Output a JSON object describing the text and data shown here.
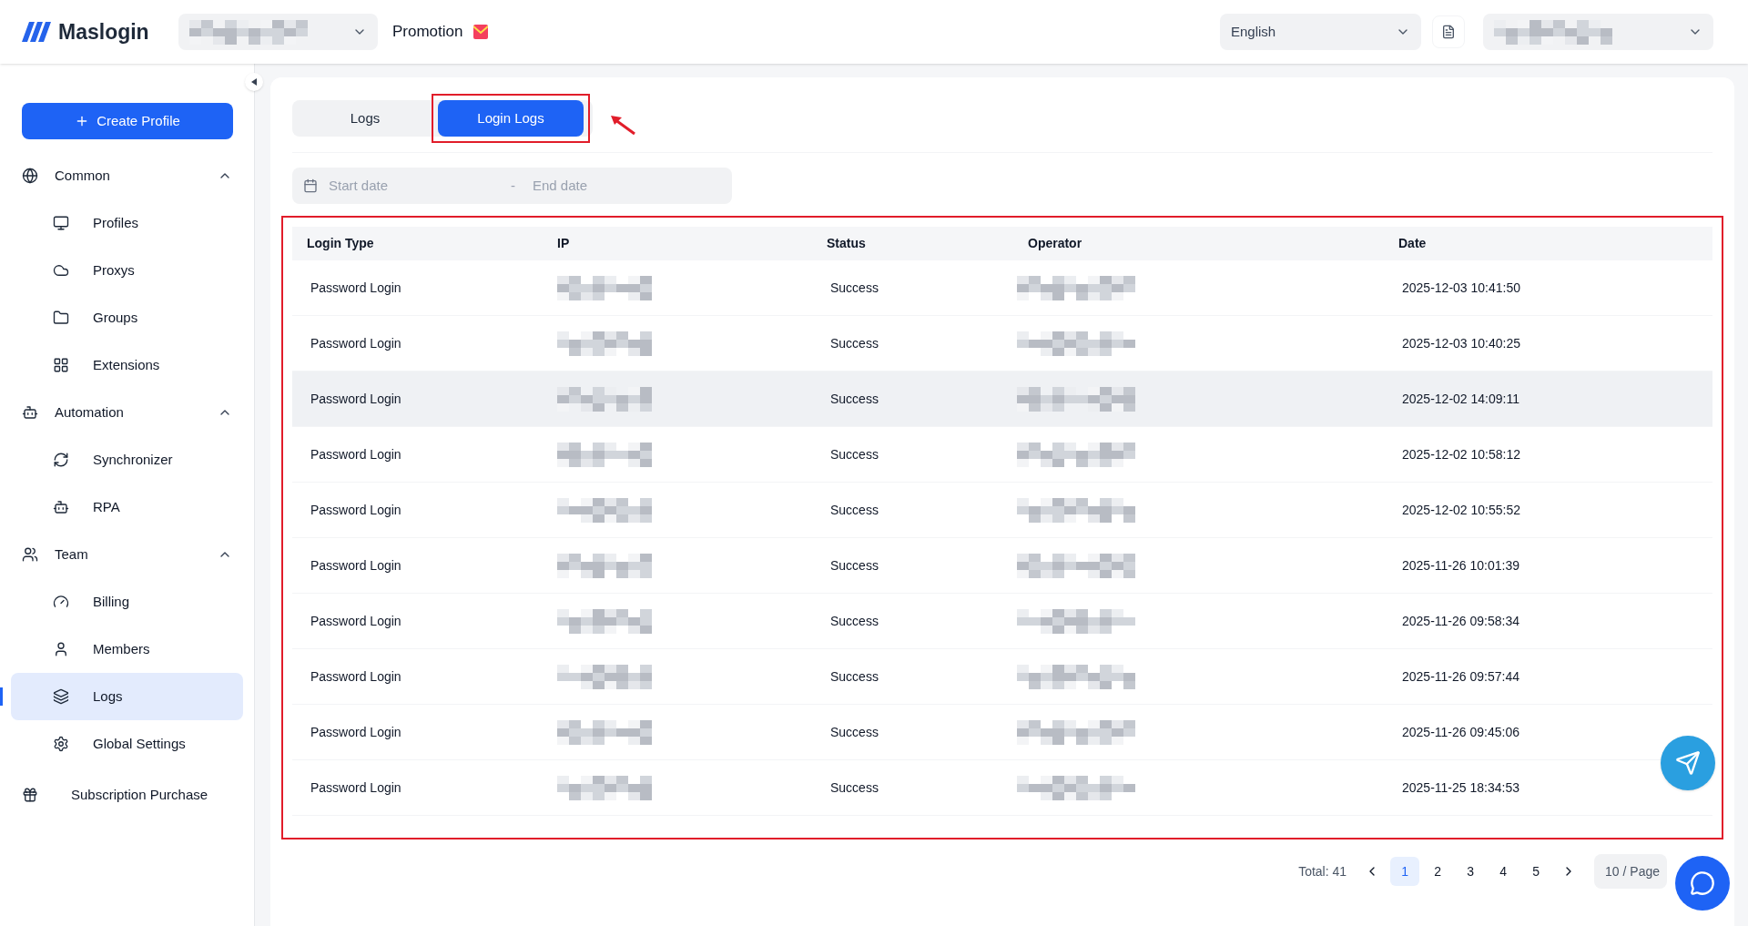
{
  "header": {
    "logo": "Maslogin",
    "promotion": "Promotion",
    "language": "English"
  },
  "sidebar": {
    "create_button": "Create Profile",
    "groups": [
      {
        "label": "Common",
        "expanded": true,
        "children": [
          {
            "label": "Profiles",
            "selected": false
          },
          {
            "label": "Proxys",
            "selected": false
          },
          {
            "label": "Groups",
            "selected": false
          },
          {
            "label": "Extensions",
            "selected": false
          }
        ]
      },
      {
        "label": "Automation",
        "expanded": true,
        "children": [
          {
            "label": "Synchronizer",
            "selected": false
          },
          {
            "label": "RPA",
            "selected": false
          }
        ]
      },
      {
        "label": "Team",
        "expanded": true,
        "children": [
          {
            "label": "Billing",
            "selected": false
          },
          {
            "label": "Members",
            "selected": false
          },
          {
            "label": "Logs",
            "selected": true
          },
          {
            "label": "Global Settings",
            "selected": false
          }
        ]
      }
    ],
    "bottom_item": "Subscription Purchase"
  },
  "tabs": [
    {
      "label": "Logs",
      "selected": false
    },
    {
      "label": "Login Logs",
      "selected": true
    }
  ],
  "date_range": {
    "start_placeholder": "Start date",
    "separator": "-",
    "end_placeholder": "End date"
  },
  "table": {
    "columns": [
      "Login Type",
      "IP",
      "Status",
      "Operator",
      "Date"
    ],
    "rows": [
      {
        "login_type": "Password Login",
        "status": "Success",
        "date": "2025-12-03 10:41:50",
        "hovered": false
      },
      {
        "login_type": "Password Login",
        "status": "Success",
        "date": "2025-12-03 10:40:25",
        "hovered": false
      },
      {
        "login_type": "Password Login",
        "status": "Success",
        "date": "2025-12-02 14:09:11",
        "hovered": true
      },
      {
        "login_type": "Password Login",
        "status": "Success",
        "date": "2025-12-02 10:58:12",
        "hovered": false
      },
      {
        "login_type": "Password Login",
        "status": "Success",
        "date": "2025-12-02 10:55:52",
        "hovered": false
      },
      {
        "login_type": "Password Login",
        "status": "Success",
        "date": "2025-11-26 10:01:39",
        "hovered": false
      },
      {
        "login_type": "Password Login",
        "status": "Success",
        "date": "2025-11-26 09:58:34",
        "hovered": false
      },
      {
        "login_type": "Password Login",
        "status": "Success",
        "date": "2025-11-26 09:57:44",
        "hovered": false
      },
      {
        "login_type": "Password Login",
        "status": "Success",
        "date": "2025-11-26 09:45:06",
        "hovered": false
      },
      {
        "login_type": "Password Login",
        "status": "Success",
        "date": "2025-11-25 18:34:53",
        "hovered": false
      }
    ]
  },
  "pagination": {
    "total": "Total: 41",
    "pages": [
      {
        "label": "1",
        "selected": true
      },
      {
        "label": "2",
        "selected": false
      },
      {
        "label": "3",
        "selected": false
      },
      {
        "label": "4",
        "selected": false
      },
      {
        "label": "5",
        "selected": false
      }
    ],
    "page_size": "10 / Page"
  }
}
